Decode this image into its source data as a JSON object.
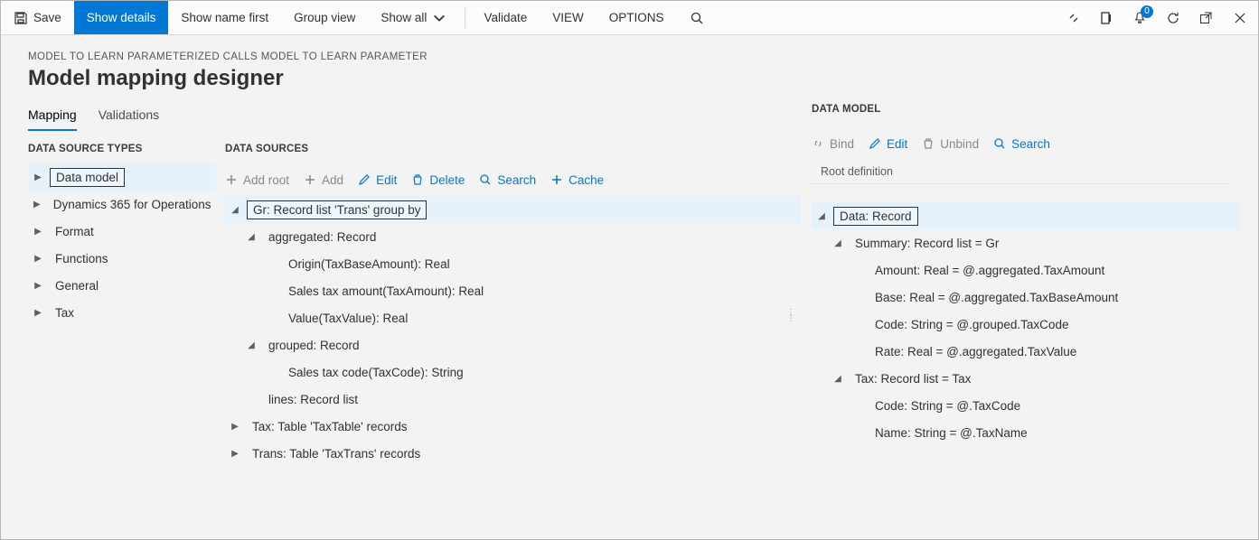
{
  "cmdbar": {
    "save": "Save",
    "show_details": "Show details",
    "show_name_first": "Show name first",
    "group_view": "Group view",
    "show_all": "Show all",
    "validate": "Validate",
    "view": "VIEW",
    "options": "OPTIONS",
    "bell_badge": "0"
  },
  "breadcrumb": "MODEL TO LEARN PARAMETERIZED CALLS MODEL TO LEARN PARAMETER",
  "page_title": "Model mapping designer",
  "tabs": {
    "mapping": "Mapping",
    "validations": "Validations"
  },
  "left": {
    "header": "DATA SOURCE TYPES",
    "items": [
      "Data model",
      "Dynamics 365 for Operations",
      "Format",
      "Functions",
      "General",
      "Tax"
    ]
  },
  "mid": {
    "header": "DATA SOURCES",
    "toolbar": {
      "add_root": "Add root",
      "add": "Add",
      "edit": "Edit",
      "delete": "Delete",
      "search": "Search",
      "cache": "Cache"
    },
    "tree": {
      "gr": "Gr: Record list 'Trans' group by",
      "aggregated": "aggregated: Record",
      "origin": "Origin(TaxBaseAmount): Real",
      "salestax_amt": "Sales tax amount(TaxAmount): Real",
      "value": "Value(TaxValue): Real",
      "grouped": "grouped: Record",
      "salestax_code": "Sales tax code(TaxCode): String",
      "lines": "lines: Record list",
      "tax": "Tax: Table 'TaxTable' records",
      "trans": "Trans: Table 'TaxTrans' records"
    }
  },
  "right": {
    "header": "DATA MODEL",
    "toolbar": {
      "bind": "Bind",
      "edit": "Edit",
      "unbind": "Unbind",
      "search": "Search"
    },
    "sub": "Root definition",
    "tree": {
      "data": "Data: Record",
      "summary": "Summary: Record list = Gr",
      "amount": "Amount: Real = @.aggregated.TaxAmount",
      "base": "Base: Real = @.aggregated.TaxBaseAmount",
      "code": "Code: String = @.grouped.TaxCode",
      "rate": "Rate: Real = @.aggregated.TaxValue",
      "tax": "Tax: Record list = Tax",
      "tax_code": "Code: String = @.TaxCode",
      "tax_name": "Name: String = @.TaxName"
    }
  }
}
